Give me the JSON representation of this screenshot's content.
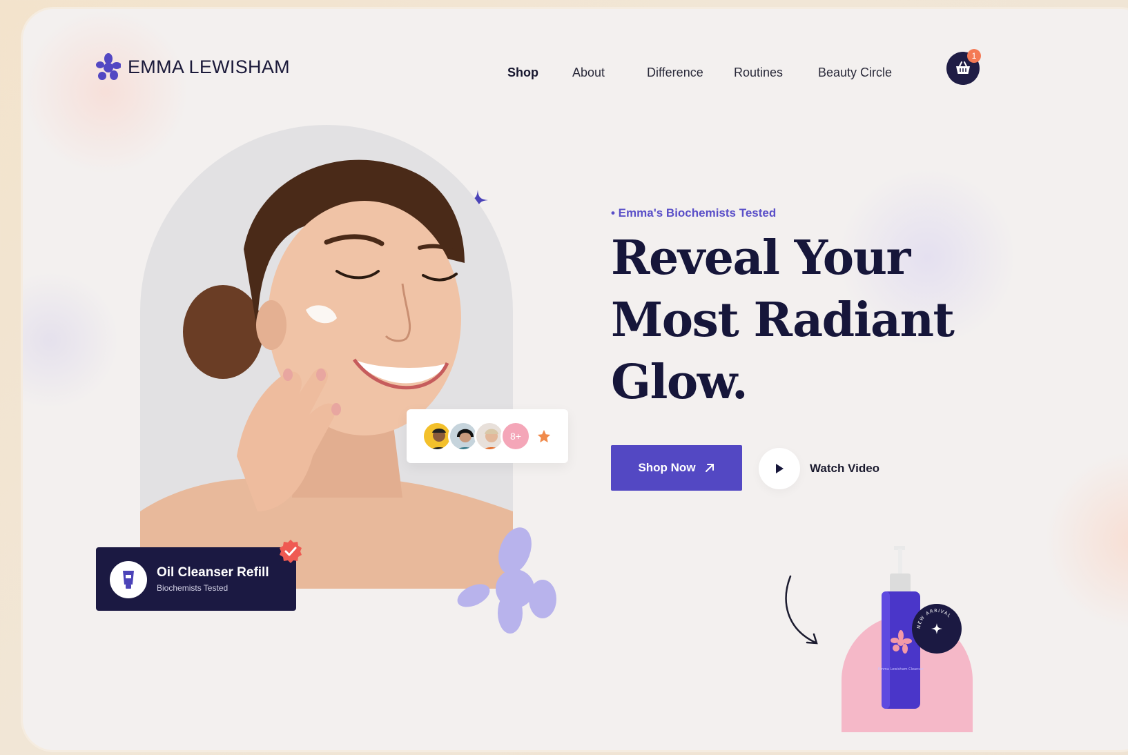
{
  "brand": {
    "name": "EMMA LEWISHAM",
    "accent": "#5348c3",
    "dark": "#1b1942"
  },
  "nav": {
    "items": [
      {
        "label": "Shop",
        "active": true
      },
      {
        "label": "About",
        "active": false
      },
      {
        "label": "Difference",
        "active": false
      },
      {
        "label": "Routines",
        "active": false
      },
      {
        "label": "Beauty Circle",
        "active": false
      }
    ],
    "cart_count": "1"
  },
  "hero": {
    "eyebrow": "• Emma's Biochemists Tested",
    "headline": [
      "Reveal Your",
      "Most Radiant",
      "Glow."
    ],
    "shop_button": "Shop Now",
    "watch_label": "Watch Video"
  },
  "community": {
    "more_count": "8+"
  },
  "product_tag": {
    "title": "Oil Cleanser Refill",
    "subtitle": "Biochemists Tested"
  },
  "new_arrival": {
    "badge_text": "NEW ARRIVAL",
    "bottle_label": "Emma Lewisham Cleanser"
  }
}
